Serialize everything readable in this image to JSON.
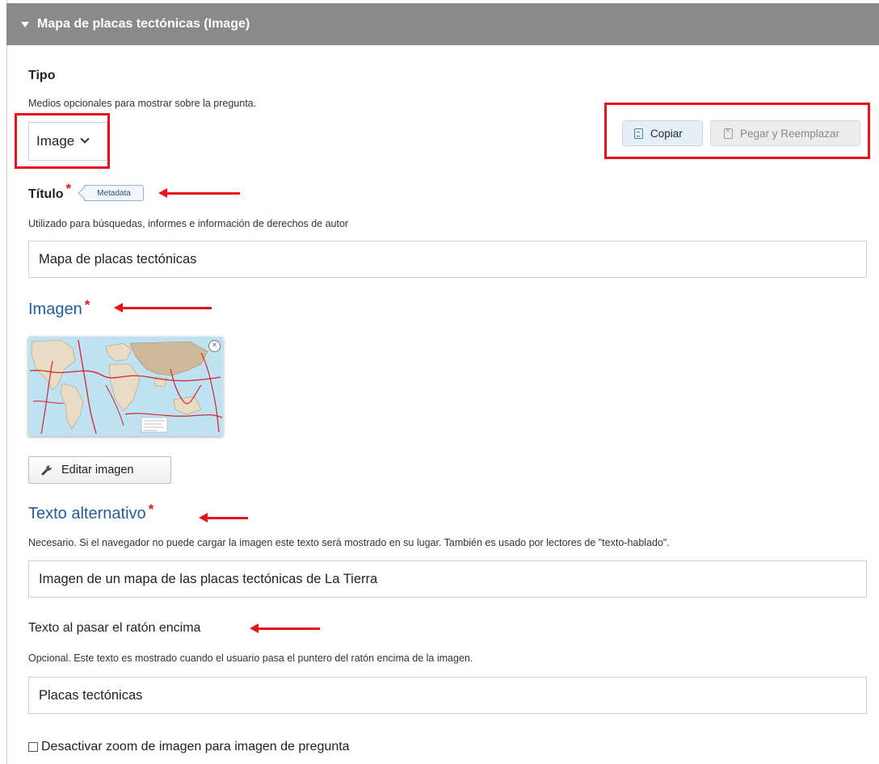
{
  "section": {
    "title": "Mapa de placas tectónicas (Image)"
  },
  "tipo": {
    "label": "Tipo",
    "description": "Medios opcionales para mostrar sobre la pregunta.",
    "selected": "Image"
  },
  "actions": {
    "copy_label": "Copiar",
    "paste_label": "Pegar y Reemplazar"
  },
  "titulo": {
    "label": "Título",
    "required_mark": "*",
    "badge": "Metadata",
    "description": "Utilizado para búsquedas, informes e información de derechos de autor",
    "value": "Mapa de placas tectónicas"
  },
  "imagen": {
    "label": "Imagen",
    "required_mark": "*",
    "close_glyph": "×",
    "edit_label": "Editar imagen"
  },
  "alt_text": {
    "label": "Texto alternativo",
    "required_mark": "*",
    "description": "Necesario. Si el navegador no puede cargar la imagen este texto será mostrado en su lugar. También es usado por lectores de \"texto-hablado\".",
    "value": "Imagen de un mapa de las placas tectónicas de La Tierra"
  },
  "hover_text": {
    "label": "Texto al pasar el ratón encima",
    "description": "Opcional. Este texto es mostrado cuando el usuario pasa el puntero del ratón encima de la imagen.",
    "value": "Placas tectónicas"
  },
  "zoom": {
    "label": "Desactivar zoom de imagen para imagen de pregunta",
    "checked": false
  },
  "colors": {
    "header_bg": "#8a8a8a",
    "annotation_red": "#e8131a",
    "link_blue": "#1f5d9b",
    "required_red": "#e0161b"
  },
  "icons": [
    "caret-down-icon",
    "chevron-down-icon",
    "copy-icon",
    "paste-icon",
    "close-icon",
    "wrench-icon"
  ]
}
